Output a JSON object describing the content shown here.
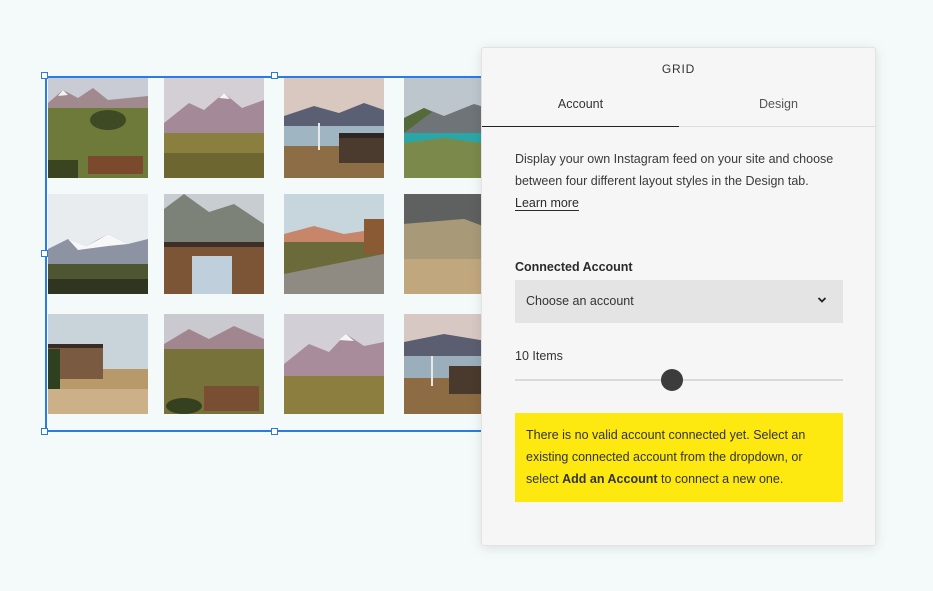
{
  "panel": {
    "title": "GRID",
    "tabs": [
      {
        "label": "Account",
        "active": true
      },
      {
        "label": "Design",
        "active": false
      }
    ],
    "description": "Display your own Instagram feed on your site and choose between four different layout styles in the Design tab.",
    "learn_more": "Learn more",
    "connected_account": {
      "label": "Connected Account",
      "selected": "Choose an account"
    },
    "items": {
      "label": "10 Items",
      "value": 10
    },
    "warning": {
      "text_before": "There is no valid account connected yet. Select an existing connected account from the dropdown, or select ",
      "link_text": "Add an Account",
      "text_after": " to connect a new one.",
      "color": "#fde80f"
    }
  },
  "colors": {
    "selection": "#2c7be5",
    "background": "#f3faf9"
  }
}
